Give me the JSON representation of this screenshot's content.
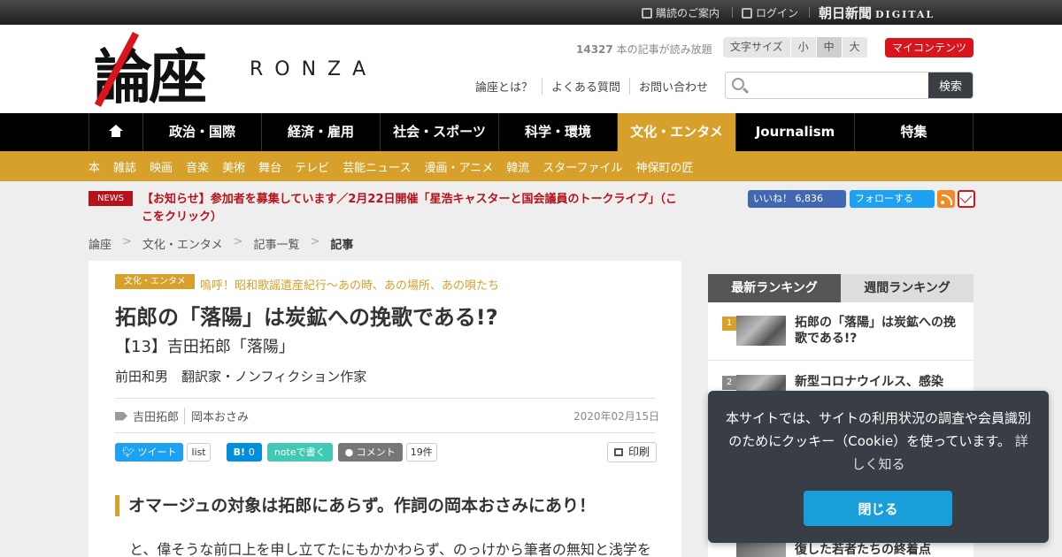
{
  "topbar": {
    "subscribe": "購読のご案内",
    "login": "ログイン",
    "brand": "朝日新聞",
    "brand_sub": "DIGITAL"
  },
  "header": {
    "logo_kanji": "論座",
    "logo_latin": "RONZA",
    "read_count_num": "14327",
    "read_count_text": " 本の記事が読み放題",
    "font_size_label": "文字サイズ",
    "font_sizes": [
      "小",
      "中",
      "大"
    ],
    "font_size_selected": "中",
    "my_contents": "マイコンテンツ",
    "links": [
      "論座とは？",
      "よくある質問",
      "お問い合わせ"
    ],
    "search_placeholder": "",
    "search_button": "検索"
  },
  "nav": {
    "items": [
      "政治・国際",
      "経済・雇用",
      "社会・スポーツ",
      "科学・環境",
      "文化・エンタメ",
      "Journalism",
      "特集"
    ],
    "active": "文化・エンタメ"
  },
  "subnav": {
    "items": [
      "本",
      "雑誌",
      "映画",
      "音楽",
      "美術",
      "舞台",
      "テレビ",
      "芸能ニュース",
      "漫画・アニメ",
      "韓流",
      "スターファイル",
      "神保町の匠"
    ]
  },
  "news": {
    "badge": "NEWS",
    "text": "【お知らせ】参加者を募集しています／2月22日開催「星浩キャスターと国会議員のトークライブ」（ここをクリック）"
  },
  "social": {
    "facebook": "いいね！ 6,836",
    "twitter": "フォローする"
  },
  "breadcrumb": [
    "論座",
    "文化・エンタメ",
    "記事一覧",
    "記事"
  ],
  "article": {
    "category": "文化・エンタメ",
    "series": "嗚呼！昭和歌謡遺産紀行〜あの時、あの場所、あの唄たち",
    "title": "拓郎の「落陽」は炭鉱への挽歌である!?",
    "subtitle": "【13】吉田拓郎「落陽」",
    "author": "前田和男　翻訳家・ノンフィクション作家",
    "tags": [
      "吉田拓郎",
      "岡本おさみ"
    ],
    "date": "2020年02月15日",
    "share": {
      "tweet": "ツイート",
      "list": "list",
      "hatena_count": "0",
      "note": "noteで書く",
      "comment": "コメント",
      "comment_count": "19件",
      "print": "印刷"
    },
    "heading": "オマージュの対象は拓郎にあらず。作詞の岡本おさみにあり！",
    "body_first_line": "と、偉そうな前口上を申し立てたにもかかわらず、のっけから筆者の無知と浅学を"
  },
  "ranking": {
    "tabs": [
      "最新ランキング",
      "週間ランキング"
    ],
    "active_tab": "最新ランキング",
    "items": [
      {
        "rank": "1",
        "title": "拓郎の「落陽」は炭鉱への挽歌である!?"
      },
      {
        "rank": "2",
        "title": "新型コロナウイルス、感染"
      }
    ],
    "partial_title": "復した若者たちの終着点"
  },
  "cookie": {
    "message": "本サイトでは、サイトの利用状況の調査や会員識別のためにクッキー（Cookie）を使っています。",
    "more": "詳しく知る",
    "close": "閉じる"
  },
  "colors": {
    "accent": "#d6a02a",
    "brand_red": "#d9141b",
    "nav_bg": "#000000",
    "cookie_button": "#1a9ed9"
  }
}
